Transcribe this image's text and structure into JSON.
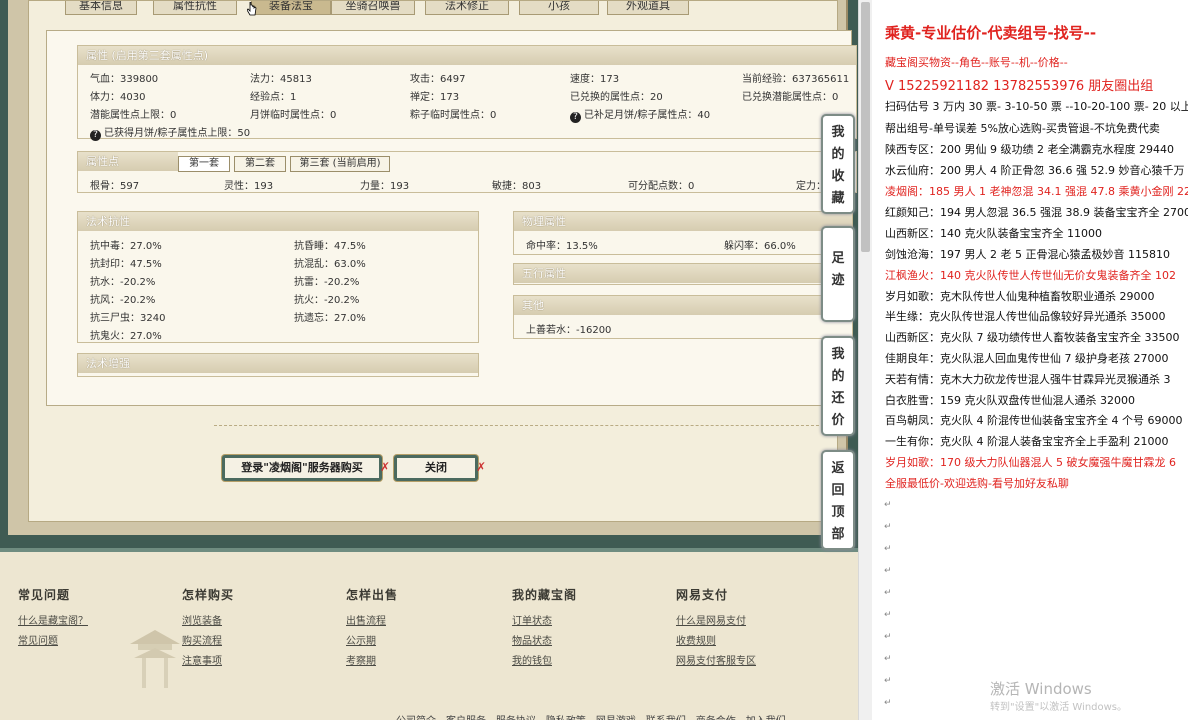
{
  "top_tabs": [
    "基本信息",
    "属性抗性",
    "装备法宝",
    "坐骑召唤兽",
    "法术修正",
    "小孩",
    "外观道具"
  ],
  "attributes": {
    "title": "属性 (启用第三套属性点)",
    "rows": [
      [
        {
          "l": "气血：339800"
        },
        {
          "l": "法力：45813"
        },
        {
          "l": "攻击：6497"
        },
        {
          "l": "速度：173"
        },
        {
          "l": "当前经验：637365611"
        }
      ],
      [
        {
          "l": "体力：4030"
        },
        {
          "l": "经验点：1"
        },
        {
          "l": "禅定：173"
        },
        {
          "l": "已兑换的属性点：20"
        },
        {
          "l": "已兑换潜能属性点：0"
        }
      ],
      [
        {
          "l": "潜能属性点上限：0"
        },
        {
          "l": "月饼临时属性点：0"
        },
        {
          "l": "粽子临时属性点：0"
        },
        {
          "l": "已补足月饼/粽子属性点：40"
        }
      ]
    ],
    "note": "已获得月饼/粽子属性点上限：50"
  },
  "points": {
    "title": "属性点",
    "tabs": [
      "第一套",
      "第二套",
      "第三套 (当前启用)"
    ],
    "values": [
      "根骨：597",
      "灵性：193",
      "力量：193",
      "敏捷：803",
      "可分配点数：0",
      "定力："
    ]
  },
  "resist": {
    "title": "法术抗性",
    "rows": [
      [
        "抗中毒：27.0%",
        "抗昏睡：47.5%"
      ],
      [
        "抗封印：47.5%",
        "抗混乱：63.0%"
      ],
      [
        "抗水：-20.2%",
        "抗雷：-20.2%"
      ],
      [
        "抗风：-20.2%",
        "抗火：-20.2%"
      ],
      [
        "抗三尸虫：3240",
        "抗遗忘：27.0%"
      ],
      [
        "抗鬼火：27.0%",
        ""
      ]
    ]
  },
  "enhance_title": "法术增强",
  "physical": {
    "title": "物理属性",
    "hit": "命中率：13.5%",
    "dodge": "躲闪率：66.0%"
  },
  "wuxing_title": "五行属性",
  "other": {
    "title": "其他",
    "value": "上善若水：-16200"
  },
  "buttons": {
    "buy": "登录\"凌烟阁\"服务器购买",
    "close": "关闭"
  },
  "footer": {
    "cols": [
      {
        "head": "常见问题",
        "links": [
          "什么是藏宝阁？",
          "常见问题"
        ]
      },
      {
        "head": "怎样购买",
        "links": [
          "浏览装备",
          "购买流程",
          "注意事项"
        ]
      },
      {
        "head": "怎样出售",
        "links": [
          "出售流程",
          "公示期",
          "考察期"
        ]
      },
      {
        "head": "我的藏宝阁",
        "links": [
          "订单状态",
          "物品状态",
          "我的钱包"
        ]
      },
      {
        "head": "网易支付",
        "links": [
          "什么是网易支付",
          "收费规则",
          "网易支付客服专区"
        ]
      }
    ],
    "bottom": "公司简介 - 客户服务 - 服务协议 - 隐私政策 - 网易游戏 - 联系我们 - 商务合作 - 加入我们"
  },
  "side_buttons": [
    {
      "label": "我的收藏"
    },
    {
      "label": "足迹"
    },
    {
      "label": "我的还价"
    },
    {
      "label": "返回顶部"
    }
  ],
  "doc": {
    "title": "乘黄-专业估价-代卖组号-找号--",
    "lines": [
      {
        "t": "藏宝阁买物资--角色--账号--机--价格--",
        "c": "red"
      },
      {
        "t": "V 15225921182      13782553976 朋友圈出组",
        "c": "red big"
      },
      {
        "t": "扫码估号 3 万内 30 票- 3-10-50 票 --10-20-100 票- 20 以上 1",
        "c": ""
      },
      {
        "t": "帮出组号-单号误差 5%放心选购-买贵管退-不坑免费代卖",
        "c": ""
      },
      {
        "t": "陕西专区：200 男仙 9 级功绩 2 老全满霸克水程度 29440",
        "c": ""
      },
      {
        "t": "水云仙府：200 男人 4 阶正骨忽 36.6 强 52.9 妙音心猿千万",
        "c": ""
      },
      {
        "t": "凌烟阁：185 男人 1 老神忽混 34.1 强混 47.8 乘黄小金刚 22",
        "c": "red"
      },
      {
        "t": "红颜知己：194 男人忽混 36.5 强混 38.9 装备宝宝齐全 2700",
        "c": ""
      },
      {
        "t": "山西新区：140 克火队装备宝宝齐全 11000",
        "c": ""
      },
      {
        "t": "剑蚀沧海：197 男人 2 老 5 正骨混心猿孟极妙音 115810",
        "c": ""
      },
      {
        "t": "江枫渔火：140 克火队传世人传世仙无价女鬼装备齐全 102",
        "c": "red"
      },
      {
        "t": "岁月如歌：克木队传世人仙鬼种植畜牧职业通杀 29000",
        "c": ""
      },
      {
        "t": "半生缘：克火队传世混人传世仙品像较好异光通杀 35000",
        "c": ""
      },
      {
        "t": "山西新区：克火队 7 级功绩传世人畜牧装备宝宝齐全 33500",
        "c": ""
      },
      {
        "t": "佳期良年：克火队混人回血鬼传世仙 7 级护身老孩 27000",
        "c": ""
      },
      {
        "t": "天若有情：克木大力砍龙传世混人强牛甘霖异光灵猴通杀 3",
        "c": ""
      },
      {
        "t": "白衣胜雪：159 克火队双盘传世仙混人通杀 32000",
        "c": ""
      },
      {
        "t": "百鸟朝凤：克火队 4 阶混传世仙装备宝宝齐全 4 个号 69000",
        "c": ""
      },
      {
        "t": "一生有你：克火队 4 阶混人装备宝宝齐全上手盈利 21000",
        "c": ""
      },
      {
        "t": "岁月如歌：170 级大力队仙器混人 5 破女魔强牛魔甘霖龙 6",
        "c": "red"
      },
      {
        "t": "全服最低价-欢迎选购-看号加好友私聊",
        "c": "red"
      }
    ]
  },
  "watermark": {
    "line1": "激活 Windows",
    "line2": "转到\"设置\"以激活 Windows。"
  }
}
